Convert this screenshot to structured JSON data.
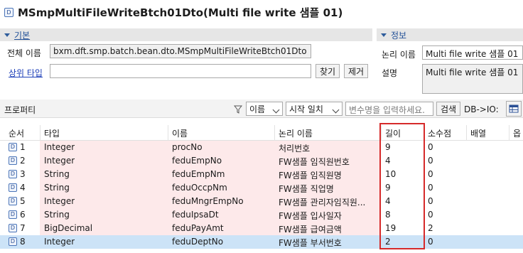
{
  "title": "MSmpMultiFileWriteBtch01Dto(Multi file write 샘플 01)",
  "basic": {
    "section_label": "기본",
    "full_name_label": "전체 이름",
    "full_name_value": "bxm.dft.smp.batch.bean.dto.MSmpMultiFileWriteBtch01Dto",
    "parent_type_label": "상위 타입",
    "parent_type_value": "",
    "find_button": "찾기",
    "remove_button": "제거"
  },
  "info": {
    "section_label": "정보",
    "logical_name_label": "논리 이름",
    "logical_name_value": "Multi file write 샘플 01",
    "description_label": "설명",
    "description_value": "Multi file write 샘플 01"
  },
  "property_bar": {
    "label": "프로퍼티",
    "filter_field": "이름",
    "match_mode": "시작 일치",
    "search_placeholder": "변수명을 입력하세요.",
    "search_button": "검색",
    "mapping_label": "DB->IO:"
  },
  "columns": [
    "순서",
    "타입",
    "이름",
    "논리 이름",
    "길이",
    "소수점",
    "배열",
    "옵"
  ],
  "rows": [
    {
      "order": "1",
      "type": "Integer",
      "name": "procNo",
      "logical": "처리번호",
      "length": "9",
      "decimal": "0"
    },
    {
      "order": "2",
      "type": "Integer",
      "name": "feduEmpNo",
      "logical": "FW샘플 임직원번호",
      "length": "4",
      "decimal": "0"
    },
    {
      "order": "3",
      "type": "String",
      "name": "feduEmpNm",
      "logical": "FW샘플 임직원명",
      "length": "10",
      "decimal": "0"
    },
    {
      "order": "4",
      "type": "String",
      "name": "feduOccpNm",
      "logical": "FW샘플 직업명",
      "length": "9",
      "decimal": "0"
    },
    {
      "order": "5",
      "type": "Integer",
      "name": "feduMngrEmpNo",
      "logical": "FW샘플 관리자임직원...",
      "length": "4",
      "decimal": "0"
    },
    {
      "order": "6",
      "type": "String",
      "name": "feduIpsaDt",
      "logical": "FW샘플 입사일자",
      "length": "8",
      "decimal": "0"
    },
    {
      "order": "7",
      "type": "BigDecimal",
      "name": "feduPayAmt",
      "logical": "FW샘플 급여금액",
      "length": "19",
      "decimal": "2"
    },
    {
      "order": "8",
      "type": "Integer",
      "name": "feduDeptNo",
      "logical": "FW샘플 부서번호",
      "length": "2",
      "decimal": "0"
    }
  ],
  "colors": {
    "section_text": "#1f4e96",
    "selected_row": "#cce3f7",
    "highlight_box": "#d62a2a"
  }
}
